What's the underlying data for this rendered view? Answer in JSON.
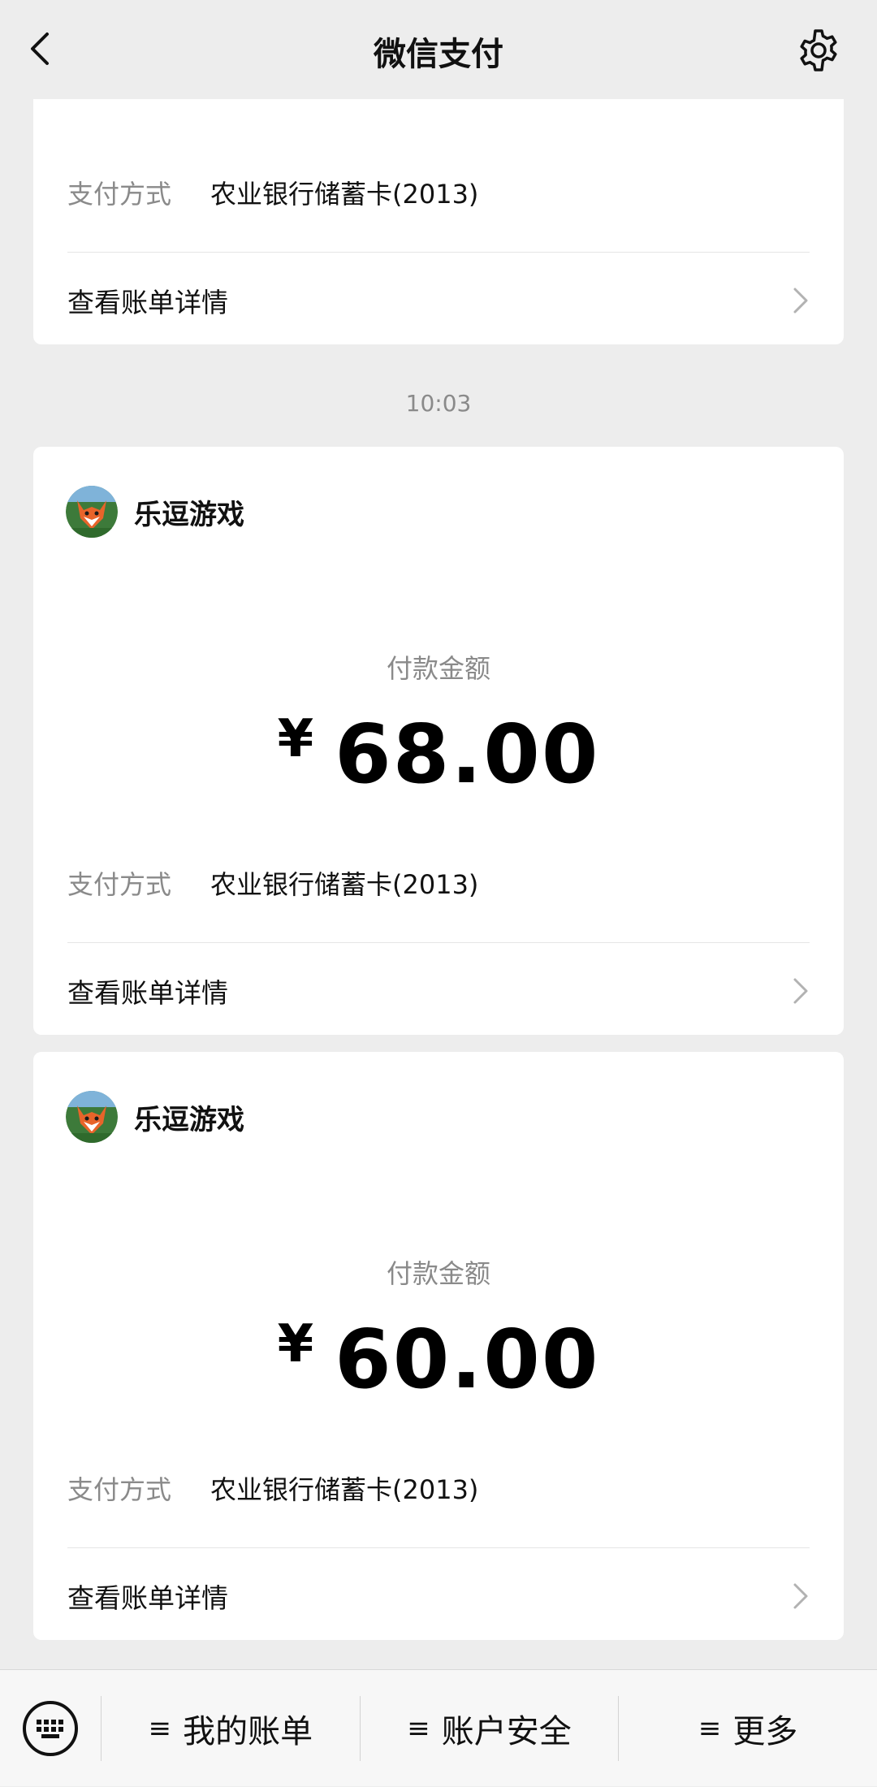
{
  "header": {
    "title": "微信支付",
    "back_icon": "chevron-left-icon",
    "settings_icon": "gear-icon"
  },
  "top_card": {
    "pay_label": "支付方式",
    "pay_method": "农业银行储蓄卡(2013)",
    "detail_label": "查看账单详情"
  },
  "time": "10:03",
  "payments": [
    {
      "merchant": "乐逗游戏",
      "amount_label": "付款金额",
      "currency": "¥",
      "amount": "68.00",
      "pay_label": "支付方式",
      "pay_method": "农业银行储蓄卡(2013)",
      "detail_label": "查看账单详情"
    },
    {
      "merchant": "乐逗游戏",
      "amount_label": "付款金额",
      "currency": "¥",
      "amount": "60.00",
      "pay_label": "支付方式",
      "pay_method": "农业银行储蓄卡(2013)",
      "detail_label": "查看账单详情"
    }
  ],
  "bottom_bar": {
    "keyboard_icon": "keyboard-icon",
    "menu_glyph": "≡",
    "items": [
      "我的账单",
      "账户安全",
      "更多"
    ]
  },
  "colors": {
    "background": "#ededed",
    "card": "#ffffff",
    "muted_text": "#8a8a8a",
    "avatar_orange": "#e8642a",
    "avatar_green": "#3d7a3a"
  }
}
